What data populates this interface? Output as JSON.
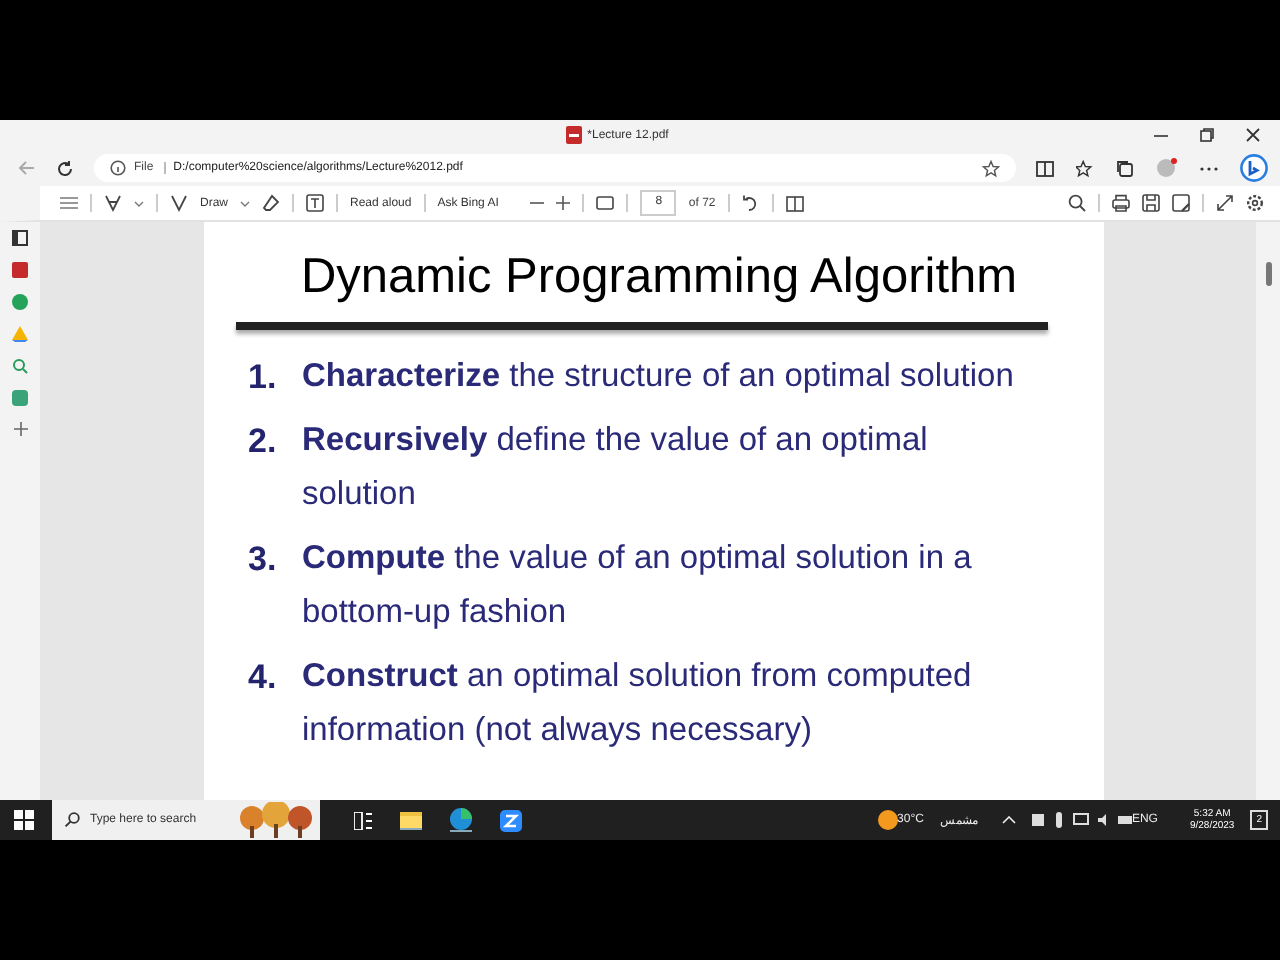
{
  "window": {
    "title": "*Lecture 12.pdf"
  },
  "address": {
    "scheme": "File",
    "url": "D:/computer%20science/algorithms/Lecture%2012.pdf"
  },
  "toolbar": {
    "draw": "Draw",
    "read_aloud": "Read aloud",
    "ask": "Ask Bing AI",
    "page": "8",
    "page_count": "of 72"
  },
  "slide": {
    "title": "Dynamic Programming Algorithm",
    "items": [
      {
        "number": "1.",
        "term": "Characterize",
        "text": "the structure of an optimal solution"
      },
      {
        "number": "2.",
        "term": "Recursively",
        "text": "define the value of an optimal solution"
      },
      {
        "number": "3.",
        "term": "Compute",
        "text": "the value of an optimal solution in a bottom-up fashion"
      },
      {
        "number": "4.",
        "term": "Construct",
        "text": "an optimal solution from computed information (not always necessary)"
      }
    ]
  },
  "taskbar": {
    "search": {
      "placeholder": "Type here to search"
    },
    "temperature": "30°C",
    "weather": "مشمس",
    "language": "ENG",
    "time": "5:32 AM",
    "date": "9/28/2023",
    "notifications": "2"
  }
}
